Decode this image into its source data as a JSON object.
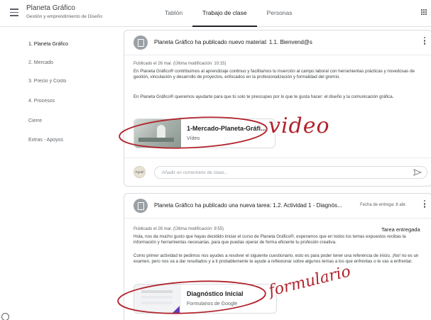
{
  "header": {
    "class_title": "Planeta Gráfico",
    "class_subtitle": "Gestión y emprendimiento de Diseño",
    "tabs": [
      {
        "label": "Tablón",
        "active": false
      },
      {
        "label": "Trabajo de clase",
        "active": true
      },
      {
        "label": "Personas",
        "active": false
      }
    ],
    "menu_icon": "hamburger-icon",
    "apps_icon": "apps-grid-icon"
  },
  "sidebar": {
    "items": [
      {
        "label": "1. Planeta Gráfico",
        "active": true
      },
      {
        "label": "2. Mercado",
        "active": false
      },
      {
        "label": "3. Precio y Costo",
        "active": false
      },
      {
        "label": "4. Procesos",
        "active": false
      },
      {
        "label": "Cierre",
        "active": false
      },
      {
        "label": "Extras - Apoyos",
        "active": false
      }
    ]
  },
  "post1": {
    "title": "Planeta Gráfico ha publicado nuevo material: 1.1. Bienvend@s",
    "meta": "Publicado el 26 mar. (Última modificación: 10:15)",
    "paragraph1": "En Planeta Gráfico® contribuimos al aprendizaje continuo y facilitamos tu inserción al campo laboral con herramientas prácticas y novedosas de gestión, vinculación y desarrollo de proyectos, enfocados en la profesionalización y formalidad del gremio.",
    "paragraph2": "En Planeta Gráfico® queremos ayudarte para que tú solo te preocupes por lo que te gusta hacer: el diseño y la comunicación gráfica.",
    "attachment": {
      "title": "1-Mercado-Planeta-Gráfi...",
      "type": "Vídeo"
    },
    "comment_placeholder": "Añadir un comentario de clase...",
    "avatar_text": "Pgráfi"
  },
  "post2": {
    "title": "Planeta Gráfico ha publicado una nueva tarea: 1.2. Actividad 1 - Diagnós...",
    "due": "Fecha de entrega: 8 abr.",
    "meta": "Publicado el 26 mar. (Última modificación: 9:55)",
    "status": "Tarea entregada",
    "paragraph1": "Hola, nos da mucho gusto que hayas decidido iniciar el curso de Planeta Gráfico®, esperamos que en todos los temas expuestos recibas la información y herramientas necesarias, para que puedas operar de forma eficiente tu profesión creativa.",
    "paragraph2": "Como primer actividad te pedimos nos ayudes a resolver el siguiente cuestionario, esto es para poder tener una referencia de inicio, ¡No! no es un examen, pero nos va a dar resultados y a ti probablemente te ayude a reflexionar sobre algunos temas a los que enfrentas o te vas a enfrentar.",
    "attachment": {
      "title": "Diagnóstico Inicial",
      "type": "Formularios de Google"
    }
  },
  "annotations": {
    "video_note": "video",
    "form_note": "formulario",
    "ink_color": "#b2232b"
  },
  "colors": {
    "accent": "#202124",
    "border": "#dadce0",
    "muted": "#5f6368",
    "forms_purple": "#673ab7"
  }
}
